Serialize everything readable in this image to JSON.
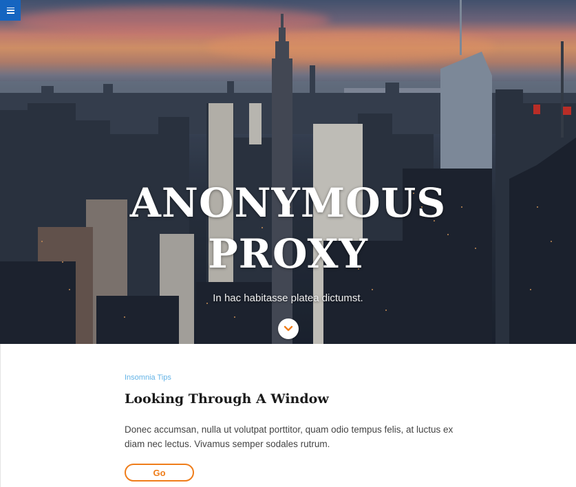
{
  "hero": {
    "title_line1": "ANONYMOUS",
    "title_line2": "PROXY",
    "subtitle": "In hac habitasse platea dictumst.",
    "scroll_icon": "chevron-down-icon",
    "menu_icon": "hamburger-menu-icon"
  },
  "post": {
    "category": "Insomnia Tips",
    "title": "Looking Through A Window",
    "excerpt": "Donec accumsan, nulla ut volutpat porttitor, quam odio tempus felis, at luctus ex diam nec lectus. Vivamus semper sodales rutrum.",
    "button_label": "Go"
  },
  "colors": {
    "menu_button": "#1565c0",
    "accent_orange": "#ef7d1a",
    "category_blue": "#63b3e6"
  }
}
